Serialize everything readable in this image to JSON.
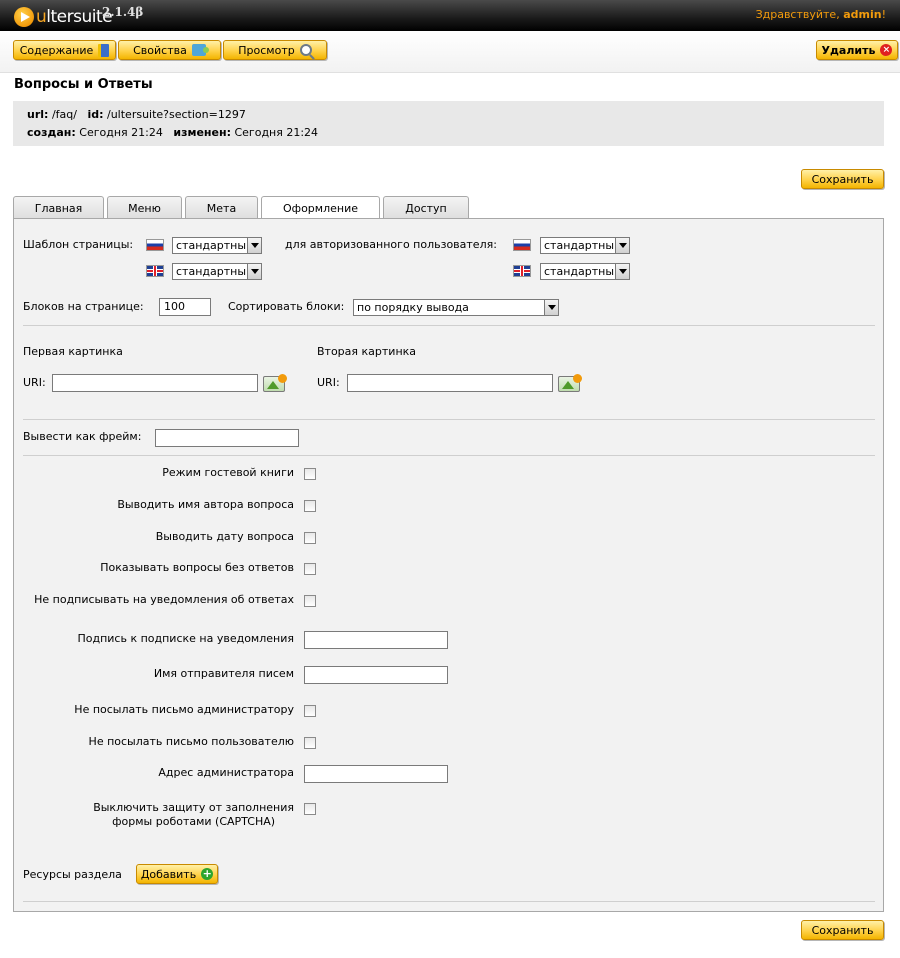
{
  "header": {
    "logo_prefix": "u",
    "logo_rest": "ltersuite",
    "version": "2.1.4β",
    "greeting": "Здравствуйте,",
    "user": "admin",
    "greeting_end": "!"
  },
  "toolbar": {
    "content_label": "Содержание",
    "properties_label": "Свойства",
    "preview_label": "Просмотр",
    "delete_label": "Удалить"
  },
  "page": {
    "title": "Вопросы и Ответы",
    "url_label": "url:",
    "url_value": "/faq/",
    "id_label": "id:",
    "id_value": "/ultersuite?section=1297",
    "created_label": "создан:",
    "created_value": "Сегодня 21:24",
    "modified_label": "изменен:",
    "modified_value": "Сегодня 21:24",
    "save_label": "Сохранить"
  },
  "tabs": [
    "Главная",
    "Меню",
    "Мета",
    "Оформление",
    "Доступ"
  ],
  "active_tab": "Оформление",
  "design": {
    "template_label": "Шаблон страницы:",
    "auth_template_label": "для авторизованного пользователя:",
    "template_ru": "стандартный",
    "template_en": "стандартный",
    "auth_template_ru": "стандартный",
    "auth_template_en": "стандартный",
    "blocks_label": "Блоков на странице:",
    "blocks_value": "100",
    "sort_label": "Сортировать блоки:",
    "sort_value": "по порядку вывода",
    "first_image_label": "Первая картинка",
    "second_image_label": "Вторая картинка",
    "uri_label": "URI:",
    "frame_label": "Вывести как фрейм:",
    "guestbook_label": "Режим гостевой книги",
    "show_author_label": "Выводить имя автора вопроса",
    "show_date_label": "Выводить дату вопроса",
    "show_unanswered_label": "Показывать вопросы без ответов",
    "no_subscribe_label": "Не подписывать на уведомления об ответах",
    "subscribe_caption_label": "Подпись к подписке на уведомления",
    "sender_name_label": "Имя отправителя писем",
    "no_admin_mail_label": "Не посылать письмо администратору",
    "no_user_mail_label": "Не посылать письмо пользователю",
    "admin_address_label": "Адрес администратора",
    "captcha_label_1": "Выключить защиту от заполнения",
    "captcha_label_2": "формы роботами (CAPTCHA)",
    "resources_label": "Ресурсы раздела",
    "add_label": "Добавить"
  },
  "colors": {
    "accent": "#f29b0c",
    "button_yellow": "#ffd24a",
    "panel_bg": "#f2f2f2"
  }
}
